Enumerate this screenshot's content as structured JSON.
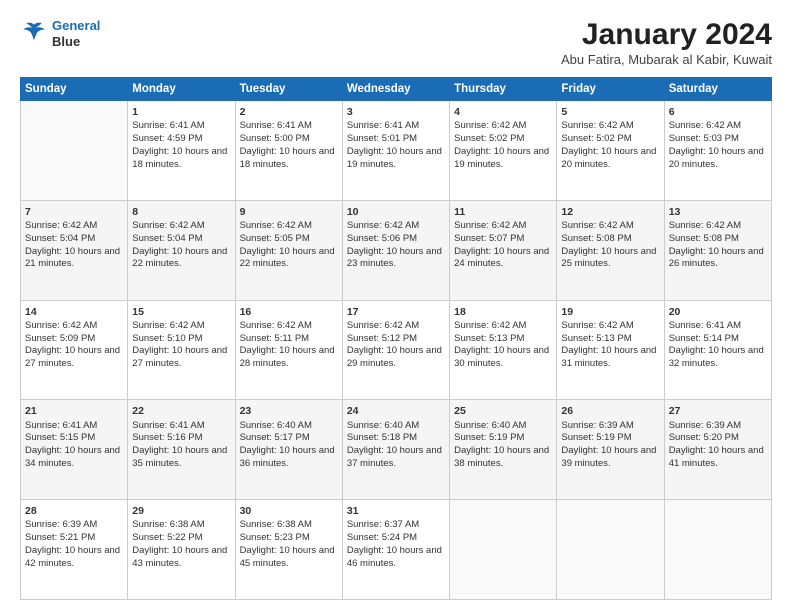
{
  "header": {
    "logo_line1": "General",
    "logo_line2": "Blue",
    "main_title": "January 2024",
    "subtitle": "Abu Fatira, Mubarak al Kabir, Kuwait"
  },
  "days_of_week": [
    "Sunday",
    "Monday",
    "Tuesday",
    "Wednesday",
    "Thursday",
    "Friday",
    "Saturday"
  ],
  "weeks": [
    [
      {
        "day": null
      },
      {
        "day": "1",
        "sunrise": "Sunrise: 6:41 AM",
        "sunset": "Sunset: 4:59 PM",
        "daylight": "Daylight: 10 hours and 18 minutes."
      },
      {
        "day": "2",
        "sunrise": "Sunrise: 6:41 AM",
        "sunset": "Sunset: 5:00 PM",
        "daylight": "Daylight: 10 hours and 18 minutes."
      },
      {
        "day": "3",
        "sunrise": "Sunrise: 6:41 AM",
        "sunset": "Sunset: 5:01 PM",
        "daylight": "Daylight: 10 hours and 19 minutes."
      },
      {
        "day": "4",
        "sunrise": "Sunrise: 6:42 AM",
        "sunset": "Sunset: 5:02 PM",
        "daylight": "Daylight: 10 hours and 19 minutes."
      },
      {
        "day": "5",
        "sunrise": "Sunrise: 6:42 AM",
        "sunset": "Sunset: 5:02 PM",
        "daylight": "Daylight: 10 hours and 20 minutes."
      },
      {
        "day": "6",
        "sunrise": "Sunrise: 6:42 AM",
        "sunset": "Sunset: 5:03 PM",
        "daylight": "Daylight: 10 hours and 20 minutes."
      }
    ],
    [
      {
        "day": "7",
        "sunrise": "Sunrise: 6:42 AM",
        "sunset": "Sunset: 5:04 PM",
        "daylight": "Daylight: 10 hours and 21 minutes."
      },
      {
        "day": "8",
        "sunrise": "Sunrise: 6:42 AM",
        "sunset": "Sunset: 5:04 PM",
        "daylight": "Daylight: 10 hours and 22 minutes."
      },
      {
        "day": "9",
        "sunrise": "Sunrise: 6:42 AM",
        "sunset": "Sunset: 5:05 PM",
        "daylight": "Daylight: 10 hours and 22 minutes."
      },
      {
        "day": "10",
        "sunrise": "Sunrise: 6:42 AM",
        "sunset": "Sunset: 5:06 PM",
        "daylight": "Daylight: 10 hours and 23 minutes."
      },
      {
        "day": "11",
        "sunrise": "Sunrise: 6:42 AM",
        "sunset": "Sunset: 5:07 PM",
        "daylight": "Daylight: 10 hours and 24 minutes."
      },
      {
        "day": "12",
        "sunrise": "Sunrise: 6:42 AM",
        "sunset": "Sunset: 5:08 PM",
        "daylight": "Daylight: 10 hours and 25 minutes."
      },
      {
        "day": "13",
        "sunrise": "Sunrise: 6:42 AM",
        "sunset": "Sunset: 5:08 PM",
        "daylight": "Daylight: 10 hours and 26 minutes."
      }
    ],
    [
      {
        "day": "14",
        "sunrise": "Sunrise: 6:42 AM",
        "sunset": "Sunset: 5:09 PM",
        "daylight": "Daylight: 10 hours and 27 minutes."
      },
      {
        "day": "15",
        "sunrise": "Sunrise: 6:42 AM",
        "sunset": "Sunset: 5:10 PM",
        "daylight": "Daylight: 10 hours and 27 minutes."
      },
      {
        "day": "16",
        "sunrise": "Sunrise: 6:42 AM",
        "sunset": "Sunset: 5:11 PM",
        "daylight": "Daylight: 10 hours and 28 minutes."
      },
      {
        "day": "17",
        "sunrise": "Sunrise: 6:42 AM",
        "sunset": "Sunset: 5:12 PM",
        "daylight": "Daylight: 10 hours and 29 minutes."
      },
      {
        "day": "18",
        "sunrise": "Sunrise: 6:42 AM",
        "sunset": "Sunset: 5:13 PM",
        "daylight": "Daylight: 10 hours and 30 minutes."
      },
      {
        "day": "19",
        "sunrise": "Sunrise: 6:42 AM",
        "sunset": "Sunset: 5:13 PM",
        "daylight": "Daylight: 10 hours and 31 minutes."
      },
      {
        "day": "20",
        "sunrise": "Sunrise: 6:41 AM",
        "sunset": "Sunset: 5:14 PM",
        "daylight": "Daylight: 10 hours and 32 minutes."
      }
    ],
    [
      {
        "day": "21",
        "sunrise": "Sunrise: 6:41 AM",
        "sunset": "Sunset: 5:15 PM",
        "daylight": "Daylight: 10 hours and 34 minutes."
      },
      {
        "day": "22",
        "sunrise": "Sunrise: 6:41 AM",
        "sunset": "Sunset: 5:16 PM",
        "daylight": "Daylight: 10 hours and 35 minutes."
      },
      {
        "day": "23",
        "sunrise": "Sunrise: 6:40 AM",
        "sunset": "Sunset: 5:17 PM",
        "daylight": "Daylight: 10 hours and 36 minutes."
      },
      {
        "day": "24",
        "sunrise": "Sunrise: 6:40 AM",
        "sunset": "Sunset: 5:18 PM",
        "daylight": "Daylight: 10 hours and 37 minutes."
      },
      {
        "day": "25",
        "sunrise": "Sunrise: 6:40 AM",
        "sunset": "Sunset: 5:19 PM",
        "daylight": "Daylight: 10 hours and 38 minutes."
      },
      {
        "day": "26",
        "sunrise": "Sunrise: 6:39 AM",
        "sunset": "Sunset: 5:19 PM",
        "daylight": "Daylight: 10 hours and 39 minutes."
      },
      {
        "day": "27",
        "sunrise": "Sunrise: 6:39 AM",
        "sunset": "Sunset: 5:20 PM",
        "daylight": "Daylight: 10 hours and 41 minutes."
      }
    ],
    [
      {
        "day": "28",
        "sunrise": "Sunrise: 6:39 AM",
        "sunset": "Sunset: 5:21 PM",
        "daylight": "Daylight: 10 hours and 42 minutes."
      },
      {
        "day": "29",
        "sunrise": "Sunrise: 6:38 AM",
        "sunset": "Sunset: 5:22 PM",
        "daylight": "Daylight: 10 hours and 43 minutes."
      },
      {
        "day": "30",
        "sunrise": "Sunrise: 6:38 AM",
        "sunset": "Sunset: 5:23 PM",
        "daylight": "Daylight: 10 hours and 45 minutes."
      },
      {
        "day": "31",
        "sunrise": "Sunrise: 6:37 AM",
        "sunset": "Sunset: 5:24 PM",
        "daylight": "Daylight: 10 hours and 46 minutes."
      },
      {
        "day": null
      },
      {
        "day": null
      },
      {
        "day": null
      }
    ]
  ]
}
